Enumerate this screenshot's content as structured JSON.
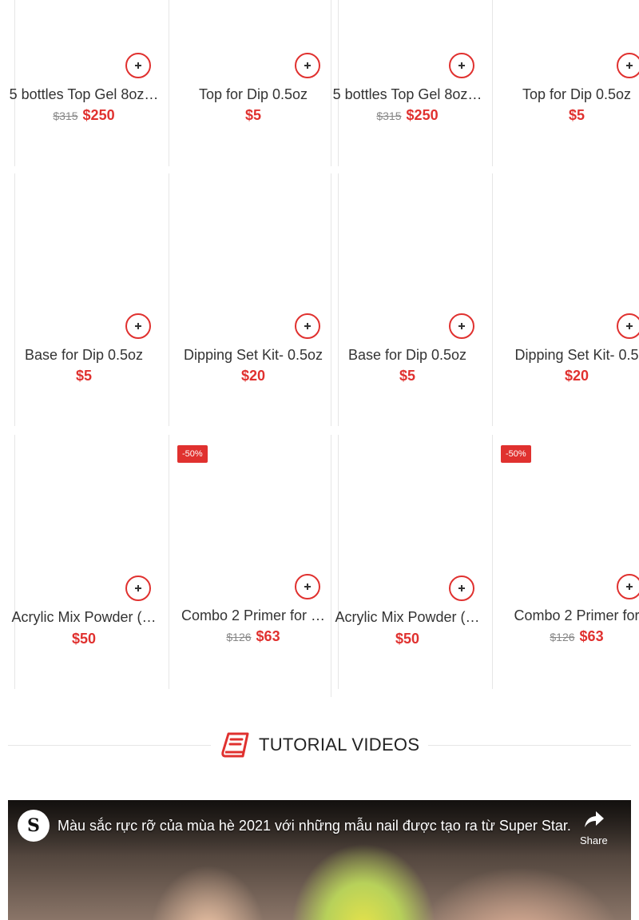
{
  "colors": {
    "accent": "#e0312f",
    "text": "#333333",
    "divider": "#e6e6e6"
  },
  "products": [
    {
      "title": "5 bottles Top Gel 8oz…",
      "old_price": "$315",
      "price": "$250",
      "badge": ""
    },
    {
      "title": "Top for Dip 0.5oz",
      "old_price": "",
      "price": "$5",
      "badge": ""
    },
    {
      "title": "5 bottles Top Gel 8oz…",
      "old_price": "$315",
      "price": "$250",
      "badge": ""
    },
    {
      "title": "Top for Dip 0.5oz",
      "old_price": "",
      "price": "$5",
      "badge": ""
    },
    {
      "title": "Base for Dip 0.5oz",
      "old_price": "",
      "price": "$5",
      "badge": ""
    },
    {
      "title": "Dipping Set Kit- 0.5oz",
      "old_price": "",
      "price": "$20",
      "badge": ""
    },
    {
      "title": "Base for Dip 0.5oz",
      "old_price": "",
      "price": "$5",
      "badge": ""
    },
    {
      "title": "Dipping Set Kit- 0.5",
      "old_price": "",
      "price": "$20",
      "badge": ""
    },
    {
      "title": "Acrylic Mix Powder (…",
      "old_price": "",
      "price": "$50",
      "badge": ""
    },
    {
      "title": "Combo 2 Primer for …",
      "old_price": "$126",
      "price": "$63",
      "badge": "-50%"
    },
    {
      "title": "Acrylic Mix Powder (…",
      "old_price": "",
      "price": "$50",
      "badge": ""
    },
    {
      "title": "Combo 2 Primer for",
      "old_price": "$126",
      "price": "$63",
      "badge": "-50%"
    }
  ],
  "section": {
    "title": "TUTORIAL VIDEOS",
    "icon": "book-icon"
  },
  "video": {
    "channel_logo": "S",
    "title": " Màu sắc rực rỡ của mùa hè 2021 với những mẫu nail được tạo ra từ Super Star.",
    "share_label": "Share"
  }
}
